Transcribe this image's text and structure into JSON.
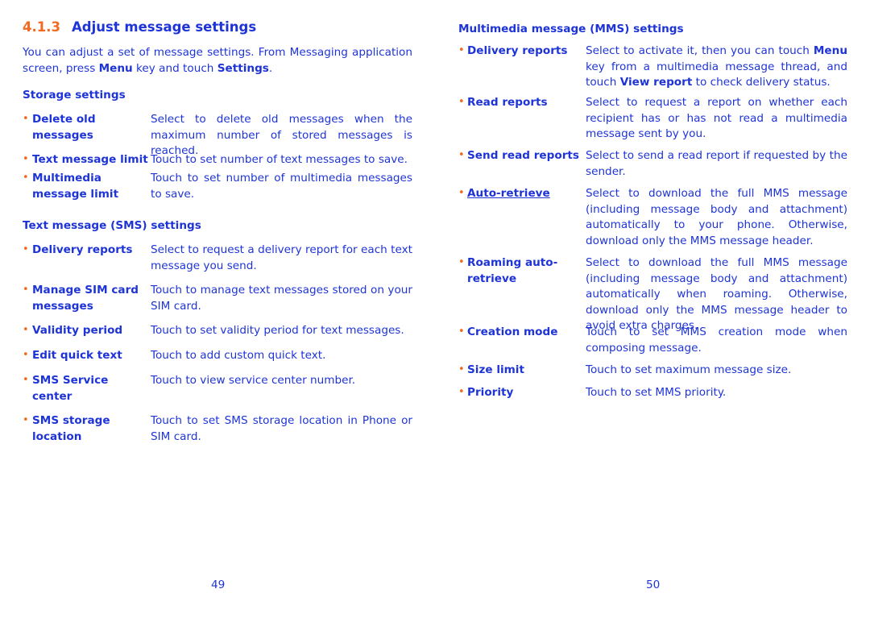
{
  "left": {
    "section_number": "4.1.3",
    "section_title": "Adjust message settings",
    "intro": [
      {
        "t": "You can adjust a set of message settings. From Messaging application screen, press "
      },
      {
        "t": "Menu",
        "b": true
      },
      {
        "t": " key and touch "
      },
      {
        "t": "Settings",
        "b": true
      },
      {
        "t": "."
      }
    ],
    "storage_header": "Storage settings",
    "storage_items": [
      {
        "term": "Delete old messages",
        "desc": [
          {
            "t": "Select to delete old messages when the maximum number of stored messages is reached."
          }
        ]
      },
      {
        "term": "Text message limit",
        "desc": [
          {
            "t": "Touch to set number of text messages to save."
          }
        ]
      },
      {
        "term": "Multimedia message limit",
        "desc": [
          {
            "t": "Touch to set number of multimedia messages to save."
          }
        ]
      }
    ],
    "sms_header": "Text message (SMS) settings",
    "sms_items": [
      {
        "term": "Delivery reports",
        "desc": [
          {
            "t": "Select to request a delivery report for each text message you send."
          }
        ]
      },
      {
        "term": "Manage SIM card messages",
        "desc": [
          {
            "t": "Touch to manage text messages stored on your SIM card."
          }
        ]
      },
      {
        "term": "Validity period",
        "desc": [
          {
            "t": "Touch to set validity period for text messages."
          }
        ]
      },
      {
        "term": "Edit quick text",
        "desc": [
          {
            "t": "Touch to add custom quick text."
          }
        ]
      },
      {
        "term": "SMS Service center",
        "desc": [
          {
            "t": "Touch to view service center number."
          }
        ]
      },
      {
        "term": "SMS storage location",
        "desc": [
          {
            "t": "Touch to set SMS storage location in Phone or SIM card."
          }
        ]
      }
    ],
    "page_number": "49"
  },
  "right": {
    "mms_header": "Multimedia message (MMS) settings",
    "mms_items": [
      {
        "term": "Delivery reports",
        "desc": [
          {
            "t": "Select to activate it, then you can touch "
          },
          {
            "t": "Menu",
            "b": true
          },
          {
            "t": " key from a multimedia message thread, and touch "
          },
          {
            "t": "View report",
            "b": true
          },
          {
            "t": " to check delivery status."
          }
        ]
      },
      {
        "term": "Read reports",
        "desc": [
          {
            "t": "Select to request a report on whether each recipient has or has not read a multimedia message sent by you."
          }
        ]
      },
      {
        "term": "Send read reports",
        "desc": [
          {
            "t": "Select to send a read report if requested by the sender."
          }
        ]
      },
      {
        "term": "Auto-retrieve",
        "underline": true,
        "desc": [
          {
            "t": "Select to download the full MMS message (including message body and attachment) automatically to your phone. Otherwise, download only the MMS message header."
          }
        ]
      },
      {
        "term": "Roaming auto-retrieve",
        "desc": [
          {
            "t": "Select to download the full MMS message (including message body and attachment) automatically when roaming. Otherwise, download only the MMS message header to avoid extra charges."
          }
        ]
      },
      {
        "term": "Creation mode",
        "desc": [
          {
            "t": "Touch to set MMS creation mode when composing message."
          }
        ]
      },
      {
        "term": "Size limit",
        "desc": [
          {
            "t": "Touch to set maximum message size."
          }
        ]
      },
      {
        "term": "Priority",
        "desc": [
          {
            "t": "Touch to set MMS priority."
          }
        ]
      }
    ],
    "page_number": "50"
  },
  "colors": {
    "text": "#1e34d6",
    "accent": "#f26a21"
  }
}
